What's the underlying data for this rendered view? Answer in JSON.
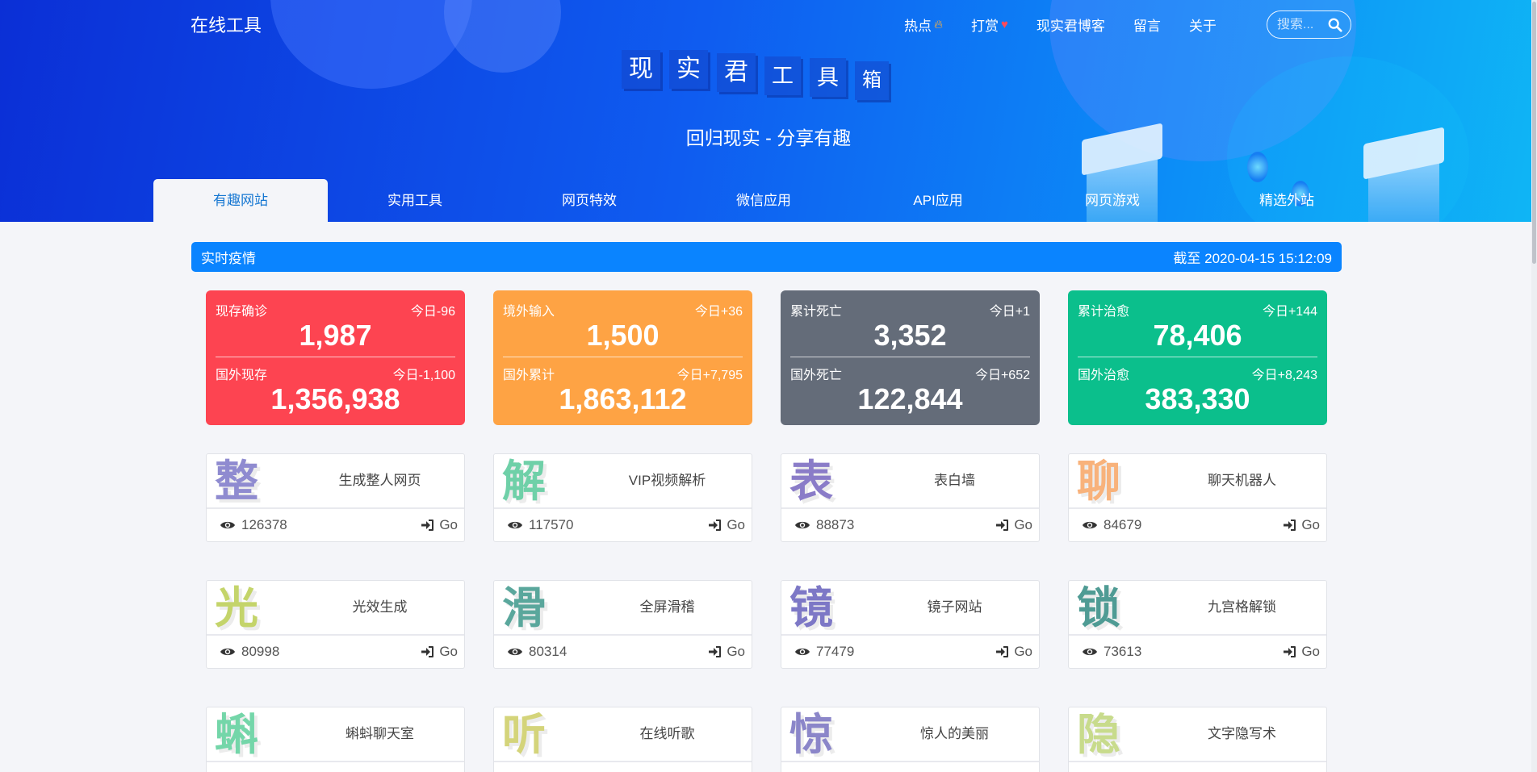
{
  "header": {
    "brand": "在线工具",
    "nav": [
      {
        "label": "热点",
        "icon": "fire-icon"
      },
      {
        "label": "打赏",
        "icon": "heart-icon"
      },
      {
        "label": "现实君博客"
      },
      {
        "label": "留言"
      },
      {
        "label": "关于"
      }
    ],
    "search_placeholder": "搜索..."
  },
  "hero": {
    "logo_chars": [
      "现",
      "实",
      "君",
      "工",
      "具",
      "箱"
    ],
    "tagline": "回归现实 - 分享有趣"
  },
  "tabs": [
    "有趣网站",
    "实用工具",
    "网页特效",
    "微信应用",
    "API应用",
    "网页游戏",
    "精选外站"
  ],
  "active_tab": "有趣网站",
  "notice": {
    "title": "实时疫情",
    "updated": "截至 2020-04-15 15:12:09"
  },
  "stats": [
    {
      "label1": "现存确诊",
      "delta1": "今日-96",
      "value1": "1,987",
      "label2": "国外现存",
      "delta2": "今日-1,100",
      "value2": "1,356,938",
      "color": "#fd4451"
    },
    {
      "label1": "境外输入",
      "delta1": "今日+36",
      "value1": "1,500",
      "label2": "国外累计",
      "delta2": "今日+7,795",
      "value2": "1,863,112",
      "color": "#fea344"
    },
    {
      "label1": "累计死亡",
      "delta1": "今日+1",
      "value1": "3,352",
      "label2": "国外死亡",
      "delta2": "今日+652",
      "value2": "122,844",
      "color": "#646c79"
    },
    {
      "label1": "累计治愈",
      "delta1": "今日+144",
      "value1": "78,406",
      "label2": "国外治愈",
      "delta2": "今日+8,243",
      "value2": "383,330",
      "color": "#0bbf8c"
    }
  ],
  "tools": [
    {
      "glyph": "整",
      "color": "#8f8bd0",
      "name": "生成整人网页",
      "views": "126378",
      "go": "Go"
    },
    {
      "glyph": "解",
      "color": "#6fd0a8",
      "name": "VIP视频解析",
      "views": "117570",
      "go": "Go"
    },
    {
      "glyph": "表",
      "color": "#8a7cc8",
      "name": "表白墙",
      "views": "88873",
      "go": "Go"
    },
    {
      "glyph": "聊",
      "color": "#f8b27b",
      "name": "聊天机器人",
      "views": "84679",
      "go": "Go"
    },
    {
      "glyph": "光",
      "color": "#c4d46a",
      "name": "光效生成",
      "views": "80998",
      "go": "Go"
    },
    {
      "glyph": "滑",
      "color": "#5aa79c",
      "name": "全屏滑稽",
      "views": "80314",
      "go": "Go"
    },
    {
      "glyph": "镜",
      "color": "#7d78c6",
      "name": "镜子网站",
      "views": "77479",
      "go": "Go"
    },
    {
      "glyph": "锁",
      "color": "#4f9b94",
      "name": "九宫格解锁",
      "views": "73613",
      "go": "Go"
    },
    {
      "glyph": "蝌",
      "color": "#74d6a9",
      "name": "蝌蚪聊天室",
      "views": "",
      "go": ""
    },
    {
      "glyph": "听",
      "color": "#d4d47a",
      "name": "在线听歌",
      "views": "",
      "go": ""
    },
    {
      "glyph": "惊",
      "color": "#8b86c9",
      "name": "惊人的美丽",
      "views": "",
      "go": ""
    },
    {
      "glyph": "隐",
      "color": "#c8db8c",
      "name": "文字隐写术",
      "views": "",
      "go": ""
    }
  ]
}
